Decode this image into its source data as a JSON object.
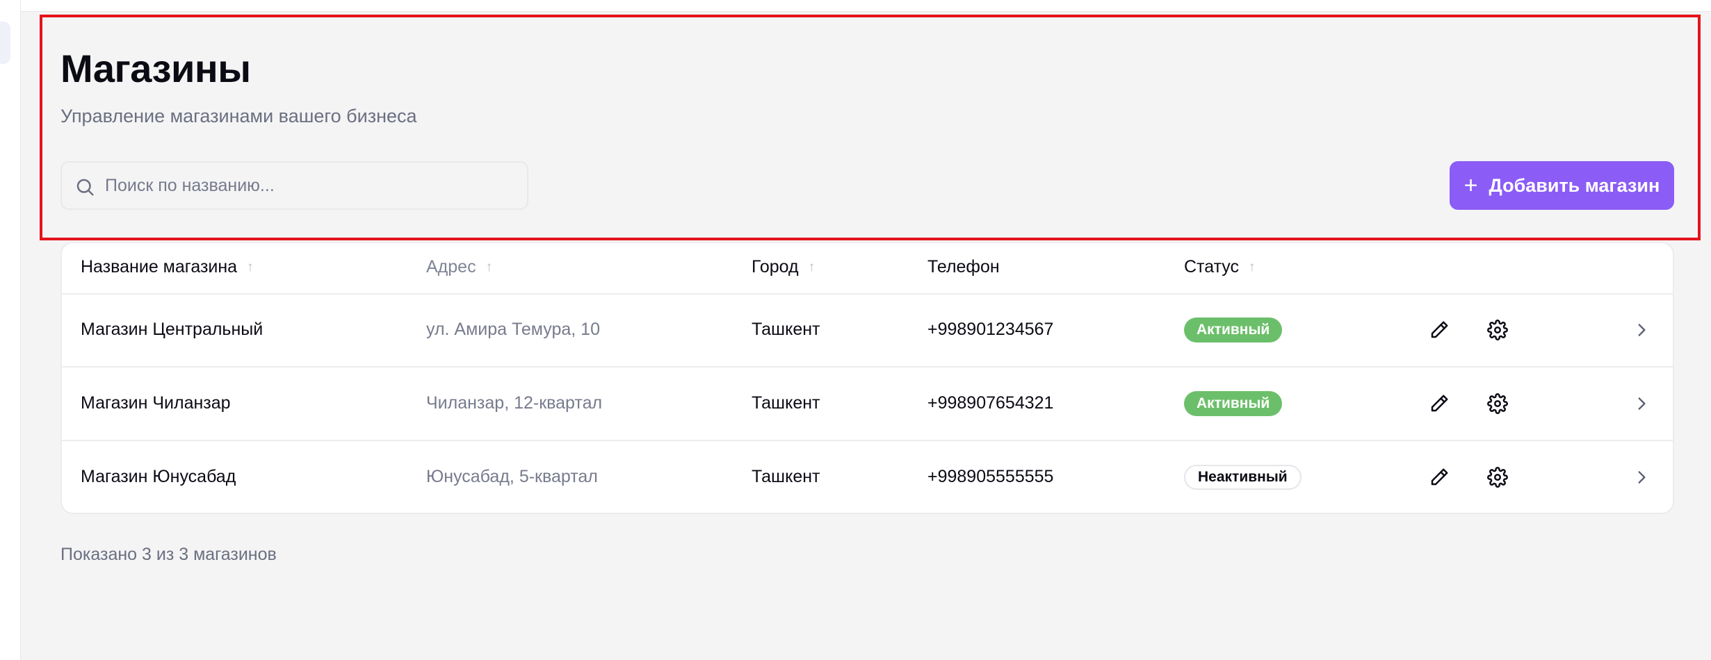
{
  "header": {
    "title": "Магазины",
    "subtitle": "Управление магазинами вашего бизнеса"
  },
  "search": {
    "placeholder": "Поиск по названию...",
    "value": "",
    "icon": "search-icon"
  },
  "add_button": {
    "label": "Добавить магазин",
    "icon": "plus-icon"
  },
  "table": {
    "columns": [
      {
        "label": "Название магазина",
        "sortable": true
      },
      {
        "label": "Адрес",
        "sortable": true
      },
      {
        "label": "Город",
        "sortable": true
      },
      {
        "label": "Телефон",
        "sortable": false
      },
      {
        "label": "Статус",
        "sortable": true
      }
    ],
    "rows": [
      {
        "name": "Магазин Центральный",
        "address": "ул. Амира Темура, 10",
        "city": "Ташкент",
        "phone": "+998901234567",
        "status": "Активный",
        "status_type": "active"
      },
      {
        "name": "Магазин Чиланзар",
        "address": "Чиланзар, 12-квартал",
        "city": "Ташкент",
        "phone": "+998907654321",
        "status": "Активный",
        "status_type": "active"
      },
      {
        "name": "Магазин Юнусабад",
        "address": "Юнусабад, 5-квартал",
        "city": "Ташкент",
        "phone": "+998905555555",
        "status": "Неактивный",
        "status_type": "inactive"
      }
    ],
    "row_actions": [
      "pencil-icon",
      "gear-icon",
      "chevron-right-icon"
    ]
  },
  "footer": {
    "count_text": "Показано 3 из 3 магазинов"
  },
  "colors": {
    "accent": "#8b5cf6",
    "active_badge": "#6cbf6a",
    "highlight": "#e5141b"
  }
}
